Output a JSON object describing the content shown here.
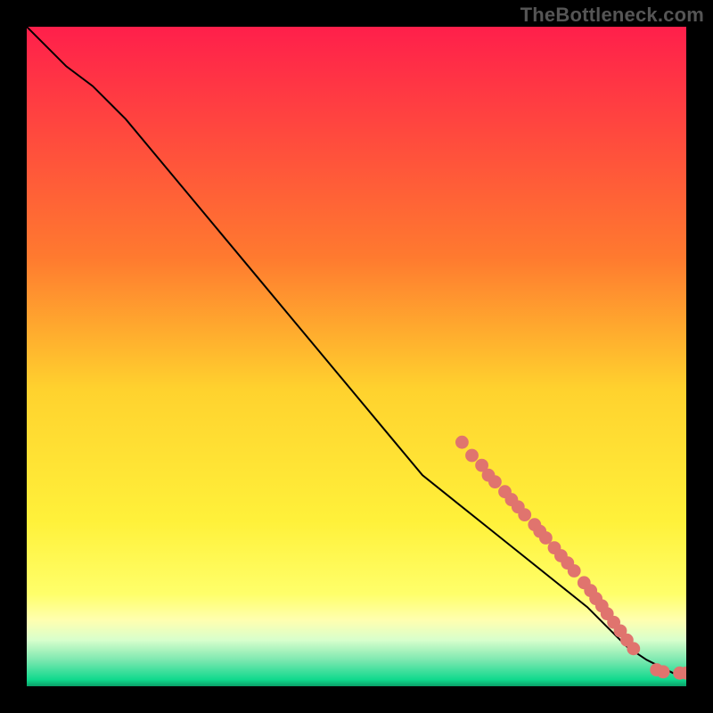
{
  "watermark": "TheBottleneck.com",
  "chart_data": {
    "type": "line",
    "title": "",
    "xlabel": "",
    "ylabel": "",
    "xlim": [
      0,
      100
    ],
    "ylim": [
      0,
      100
    ],
    "grid": false,
    "legend": false,
    "background_gradient": {
      "stops": [
        {
          "offset": 0,
          "color": "#ff1f4b"
        },
        {
          "offset": 35,
          "color": "#ff7a2f"
        },
        {
          "offset": 55,
          "color": "#ffd22e"
        },
        {
          "offset": 75,
          "color": "#fff13a"
        },
        {
          "offset": 86,
          "color": "#ffff6a"
        },
        {
          "offset": 90,
          "color": "#ffffb0"
        },
        {
          "offset": 93,
          "color": "#d8ffcc"
        },
        {
          "offset": 96,
          "color": "#7de8b0"
        },
        {
          "offset": 99,
          "color": "#10d98d"
        },
        {
          "offset": 100,
          "color": "#0a9f68"
        }
      ]
    },
    "series": [
      {
        "name": "curve",
        "color": "#000000",
        "x": [
          0,
          3,
          6,
          10,
          15,
          20,
          25,
          30,
          35,
          40,
          45,
          50,
          55,
          60,
          65,
          70,
          75,
          80,
          85,
          88,
          91,
          94,
          96,
          98,
          100
        ],
        "y": [
          100,
          97,
          94,
          91,
          86,
          80,
          74,
          68,
          62,
          56,
          50,
          44,
          38,
          32,
          28,
          24,
          20,
          16,
          12,
          9,
          6,
          4,
          3,
          2,
          2
        ]
      }
    ],
    "markers": {
      "name": "highlight-points",
      "color": "#e0746e",
      "radius_pct": 1.0,
      "points": [
        {
          "x": 66,
          "y": 37
        },
        {
          "x": 67.5,
          "y": 35
        },
        {
          "x": 69,
          "y": 33.5
        },
        {
          "x": 70,
          "y": 32
        },
        {
          "x": 71,
          "y": 31
        },
        {
          "x": 72.5,
          "y": 29.5
        },
        {
          "x": 73.5,
          "y": 28.3
        },
        {
          "x": 74.5,
          "y": 27.2
        },
        {
          "x": 75.5,
          "y": 26
        },
        {
          "x": 77,
          "y": 24.5
        },
        {
          "x": 77.8,
          "y": 23.5
        },
        {
          "x": 78.7,
          "y": 22.5
        },
        {
          "x": 80,
          "y": 21
        },
        {
          "x": 81,
          "y": 19.8
        },
        {
          "x": 82,
          "y": 18.7
        },
        {
          "x": 83,
          "y": 17.5
        },
        {
          "x": 84.5,
          "y": 15.7
        },
        {
          "x": 85.5,
          "y": 14.5
        },
        {
          "x": 86.3,
          "y": 13.3
        },
        {
          "x": 87.2,
          "y": 12.2
        },
        {
          "x": 88,
          "y": 11
        },
        {
          "x": 89,
          "y": 9.7
        },
        {
          "x": 90,
          "y": 8.4
        },
        {
          "x": 91,
          "y": 7
        },
        {
          "x": 92,
          "y": 5.7
        },
        {
          "x": 95.5,
          "y": 2.5
        },
        {
          "x": 96.5,
          "y": 2.2
        },
        {
          "x": 99,
          "y": 2
        },
        {
          "x": 100,
          "y": 2
        }
      ]
    }
  }
}
